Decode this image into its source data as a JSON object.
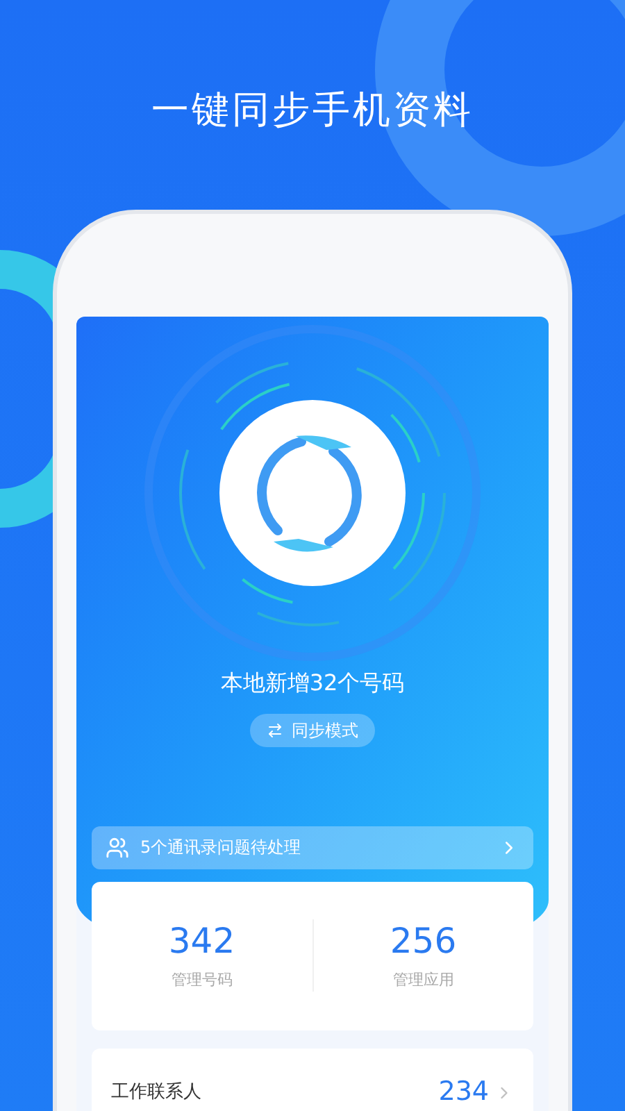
{
  "headline": "一键同步手机资料",
  "sync_status": "本地新增32个号码",
  "mode_button": "同步模式",
  "notice": "5个通讯录问题待处理",
  "stats": [
    {
      "value": "342",
      "label": "管理号码"
    },
    {
      "value": "256",
      "label": "管理应用"
    }
  ],
  "groups": [
    {
      "label": "工作联系人",
      "count": "234"
    }
  ]
}
